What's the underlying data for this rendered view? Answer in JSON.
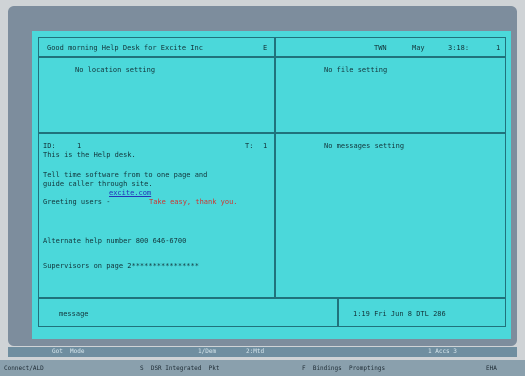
{
  "top_left_header": "Good morning Help Desk for Excite Inc",
  "top_left_flag": "E",
  "top_right_header": {
    "a": "TWN",
    "b": "May",
    "c": "3:18:",
    "d": "1"
  },
  "panel_top_left": "No location setting",
  "panel_top_right": "No file setting",
  "panel_mid_right": "No messages setting",
  "ticket": {
    "id_label": "ID:",
    "id_value": "1",
    "count_label": "T:",
    "count_value": "1",
    "line1": "This is the Help desk.",
    "line2": "Tell time software from to one page and",
    "line3": "guide caller through site.",
    "link": "excite.com",
    "greeting_label": "Greeting users -",
    "greeting_value": "Take easy, thank you.",
    "alt_help": "Alternate help number 800 646-6700",
    "supervisors": "Supervisors on page 2****************"
  },
  "bottom_left": "message",
  "bottom_right": "1:19 Fri Jun 8 DTL 286",
  "taskbar_row1": {
    "a": "Got  Mode",
    "b": "1/Dem",
    "c": "2:Mtd",
    "d": "1 Accs 3"
  },
  "taskbar_row2": {
    "a": "Connect/ALD",
    "b": "S  DSR Integrated  Pkt",
    "c": "F  Bindings  Promptings",
    "d": "EHA"
  }
}
